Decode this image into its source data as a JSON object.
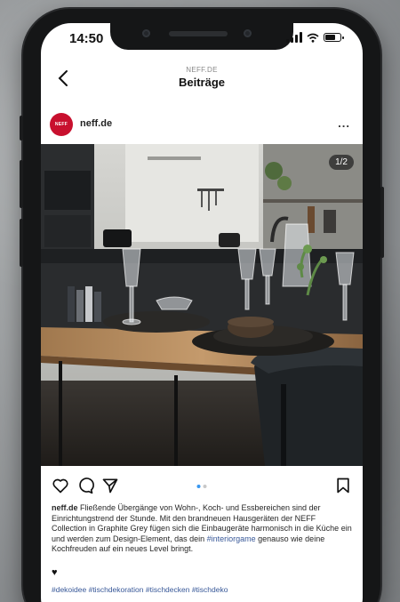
{
  "status": {
    "time": "14:50"
  },
  "nav": {
    "subtitle": "NEFF.DE",
    "title": "Beiträge"
  },
  "post": {
    "avatar_text": "NEFF",
    "username": "neff.de",
    "more": "...",
    "image_counter": "1/2",
    "caption_user": "neff.de",
    "caption_text": "Fließende Übergänge von Wohn-, Koch- und Essbereichen sind der Einrichtungstrend der Stunde. Mit den brandneuen Hausgeräten der NEFF Collection in Graphite Grey fügen sich die Einbaugeräte harmonisch in die Küche ein und werden zum Design-Element, das dein ",
    "caption_tag": "#interiorgame",
    "caption_end": " genauso wie deine Kochfreuden auf ein neues Level bringt.",
    "heart": "♥",
    "hashtags": "#dekoidee #tischdekoration #tischdecken #tischdeko"
  },
  "colors": {
    "brand": "#c8102e",
    "link": "#385898",
    "active_dot": "#3897f0"
  },
  "icons": [
    "back-arrow-icon",
    "more-icon",
    "heart-icon",
    "comment-icon",
    "share-icon",
    "bookmark-icon"
  ]
}
